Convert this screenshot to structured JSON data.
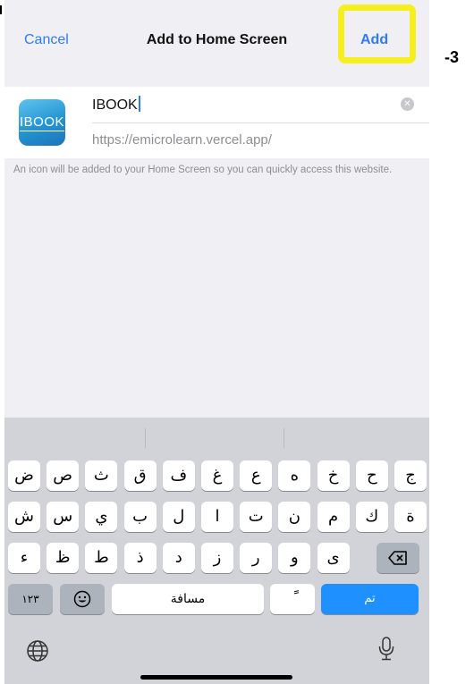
{
  "navbar": {
    "cancel_label": "Cancel",
    "title": "Add to Home Screen",
    "add_label": "Add"
  },
  "annotation": {
    "step_label": "-3",
    "highlight_color": "#f5ef1e"
  },
  "app": {
    "icon_text": "IBOOK",
    "name_value": "IBOOK",
    "url": "https://emicrolearn.vercel.app/"
  },
  "info_text": "An icon will be added to your Home Screen so you can quickly access this website.",
  "keyboard": {
    "row1": [
      "ض",
      "ص",
      "ث",
      "ق",
      "ف",
      "غ",
      "ع",
      "ه",
      "خ",
      "ح",
      "ج"
    ],
    "row2": [
      "ش",
      "س",
      "ي",
      "ب",
      "ل",
      "ا",
      "ت",
      "ن",
      "م",
      "ك",
      "ة"
    ],
    "row3": [
      "ء",
      "ظ",
      "ط",
      "ذ",
      "د",
      "ز",
      "ر",
      "و",
      "ى"
    ],
    "numbers_label": "١٢٣",
    "space_label": "مسافة",
    "tanween_label": "ً",
    "done_label": "تم",
    "icons": {
      "backspace": "backspace-icon",
      "emoji": "emoji-icon",
      "globe": "globe-icon",
      "mic": "microphone-icon"
    }
  },
  "colors": {
    "accent": "#2f7bf5",
    "return_key": "#1e90ff"
  }
}
